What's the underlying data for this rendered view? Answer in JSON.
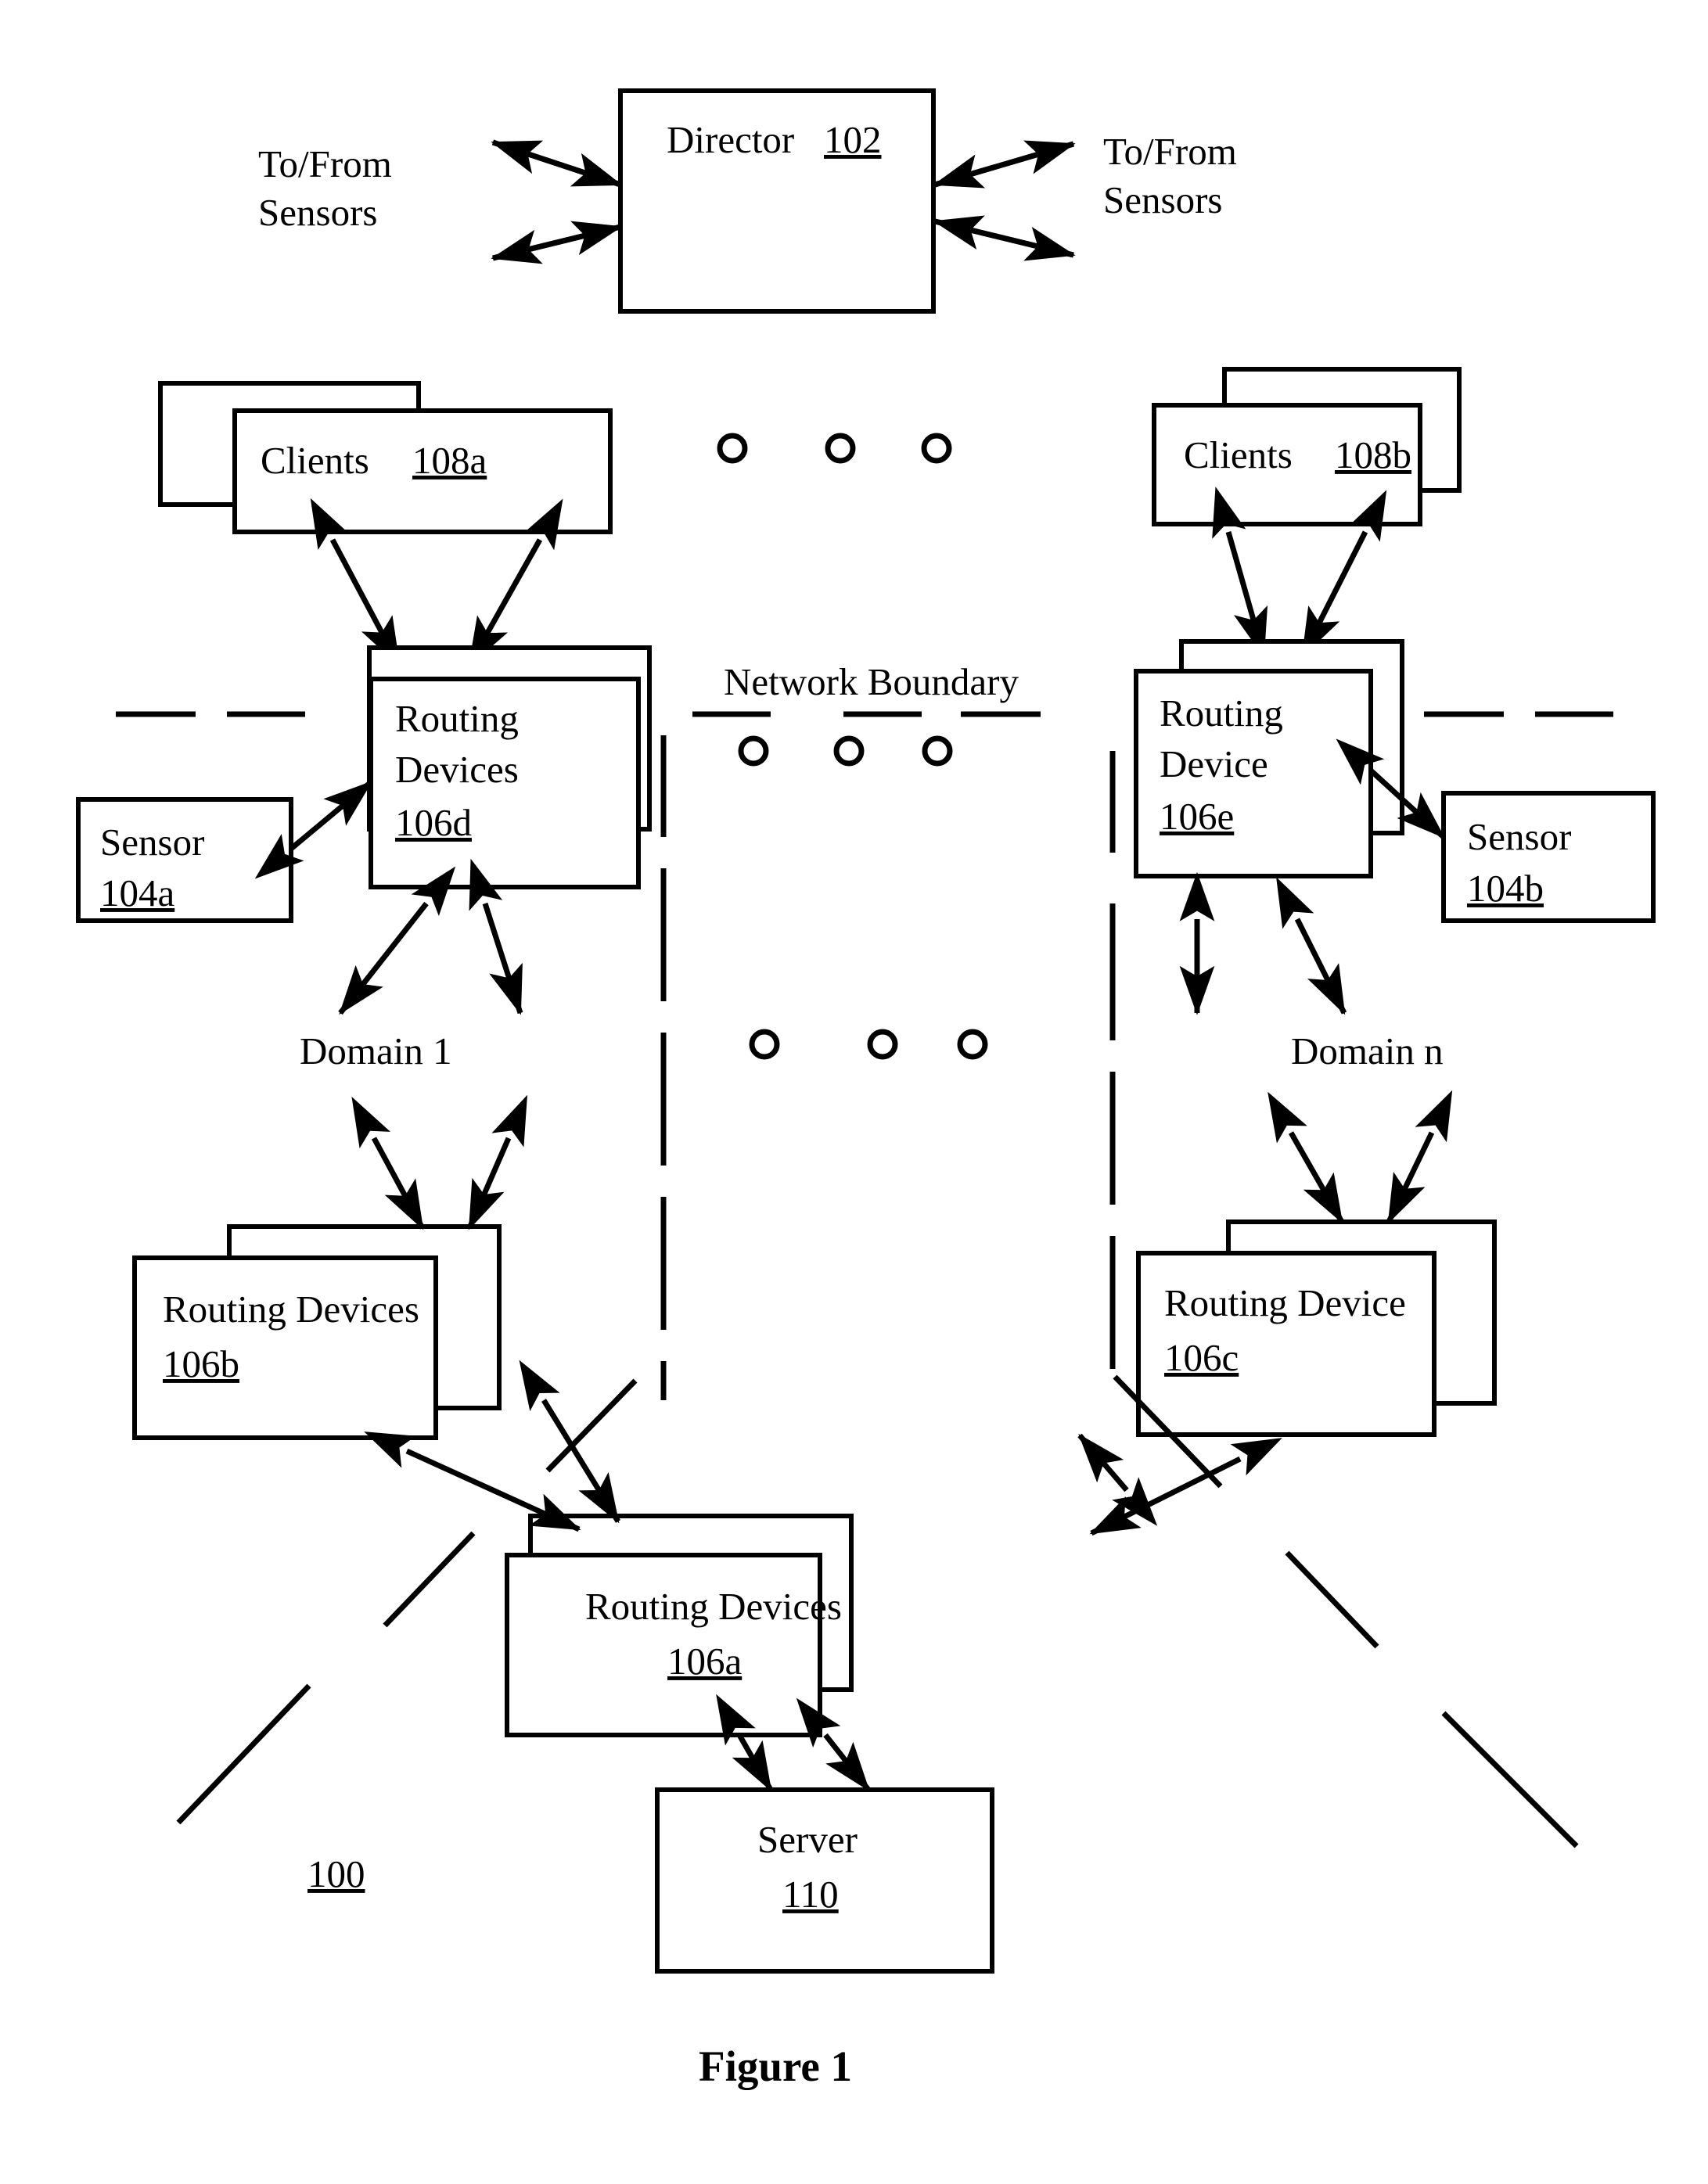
{
  "figure": {
    "caption": "Figure 1",
    "system_ref": "100"
  },
  "nodes": {
    "director": {
      "label": "Director",
      "ref": "102"
    },
    "clients_a": {
      "label": "Clients",
      "ref": "108a"
    },
    "clients_b": {
      "label": "Clients",
      "ref": "108b"
    },
    "routing_d": {
      "line1": "Routing",
      "line2": "Devices",
      "ref": "106d"
    },
    "routing_e": {
      "line1": "Routing",
      "line2": "Device",
      "ref": "106e"
    },
    "routing_b": {
      "line1": "Routing Devices",
      "ref": "106b"
    },
    "routing_c": {
      "line1": "Routing Device",
      "ref": "106c"
    },
    "routing_a": {
      "line1": "Routing Devices",
      "ref": "106a"
    },
    "sensor_a": {
      "label": "Sensor",
      "ref": "104a"
    },
    "sensor_b": {
      "label": "Sensor",
      "ref": "104b"
    },
    "server": {
      "label": "Server",
      "ref": "110"
    }
  },
  "labels": {
    "tofrom_left_line1": "To/From",
    "tofrom_left_line2": "Sensors",
    "tofrom_right_line1": "To/From",
    "tofrom_right_line2": "Sensors",
    "network_boundary": "Network Boundary",
    "domain_1": "Domain 1",
    "domain_n": "Domain n"
  },
  "ellipsis_markers": {
    "top_row_count": 3,
    "boundary_row_count": 3,
    "middle_row_count": 3,
    "glyph": "circle-outline"
  },
  "colors": {
    "stroke": "#000000",
    "fill": "#ffffff",
    "background": "#ffffff"
  }
}
